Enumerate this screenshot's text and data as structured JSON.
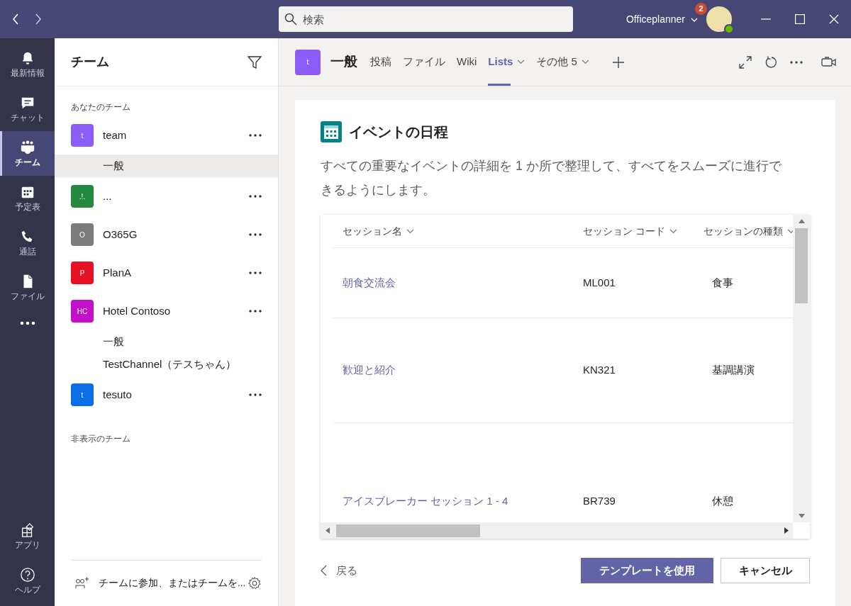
{
  "title_bar": {
    "search": {
      "placeholder": "検索"
    },
    "user": {
      "name": "Officeplanner",
      "badge": "2"
    }
  },
  "rail": [
    {
      "label": "最新情報",
      "selected": false
    },
    {
      "label": "チャット",
      "selected": false
    },
    {
      "label": "チーム",
      "selected": true
    },
    {
      "label": "予定表",
      "selected": false
    },
    {
      "label": "通話",
      "selected": false
    },
    {
      "label": "ファイル",
      "selected": false
    },
    {
      "label": "アプリ",
      "selected": false
    },
    {
      "label": "ヘルプ",
      "selected": false
    }
  ],
  "teams_panel": {
    "title": "チーム",
    "section": "あなたのチーム",
    "teams": [
      {
        "initials": "t",
        "color": "#8b5cf6",
        "name": "team",
        "children": [
          {
            "name": "一般",
            "selected": true
          }
        ]
      },
      {
        "initials": ".!.",
        "color": "#22893f",
        "name": "..."
      },
      {
        "initials": "O",
        "color": "#7a7a7a",
        "name": "O365G"
      },
      {
        "initials": "P",
        "color": "#e81123",
        "name": "PlanA"
      },
      {
        "initials": "HC",
        "color": "#c30fc7",
        "name": "Hotel Contoso",
        "children": [
          {
            "name": "一般",
            "selected": false
          },
          {
            "name": "TestChannel（テスちゃん）",
            "selected": false
          }
        ]
      },
      {
        "initials": "t",
        "color": "#0a6ee8",
        "name": "tesuto"
      }
    ],
    "hidden_section": "非表示のチーム",
    "join": "チームに参加、またはチームを..."
  },
  "channel_header": {
    "avatar": "t",
    "name": "一般",
    "tabs": [
      {
        "label": "投稿",
        "selected": false,
        "dropdown": false
      },
      {
        "label": "ファイル",
        "selected": false,
        "dropdown": false
      },
      {
        "label": "Wiki",
        "selected": false,
        "dropdown": false
      },
      {
        "label": "Lists",
        "selected": true,
        "dropdown": true
      },
      {
        "label": "その他 5",
        "selected": false,
        "dropdown": true
      }
    ]
  },
  "template": {
    "title": "イベントの日程",
    "description": "すべての重要なイベントの詳細を 1 か所で整理して、すべてをスムーズに進行できるようにします。",
    "table": {
      "columns": [
        "セッション名",
        "セッション コード",
        "セッションの種類"
      ],
      "rows": [
        [
          "朝食交流会",
          "ML001",
          "食事"
        ],
        [
          "歓迎と紹介",
          "KN321",
          "基調講演"
        ],
        [
          "アイスブレーカー セッション 1 - 4",
          "BR739",
          "休憩"
        ]
      ]
    },
    "back": "戻る",
    "buttons": [
      {
        "label": "テンプレートを使用",
        "kind": "primary"
      },
      {
        "label": "キャンセル",
        "kind": "secondary"
      }
    ]
  }
}
